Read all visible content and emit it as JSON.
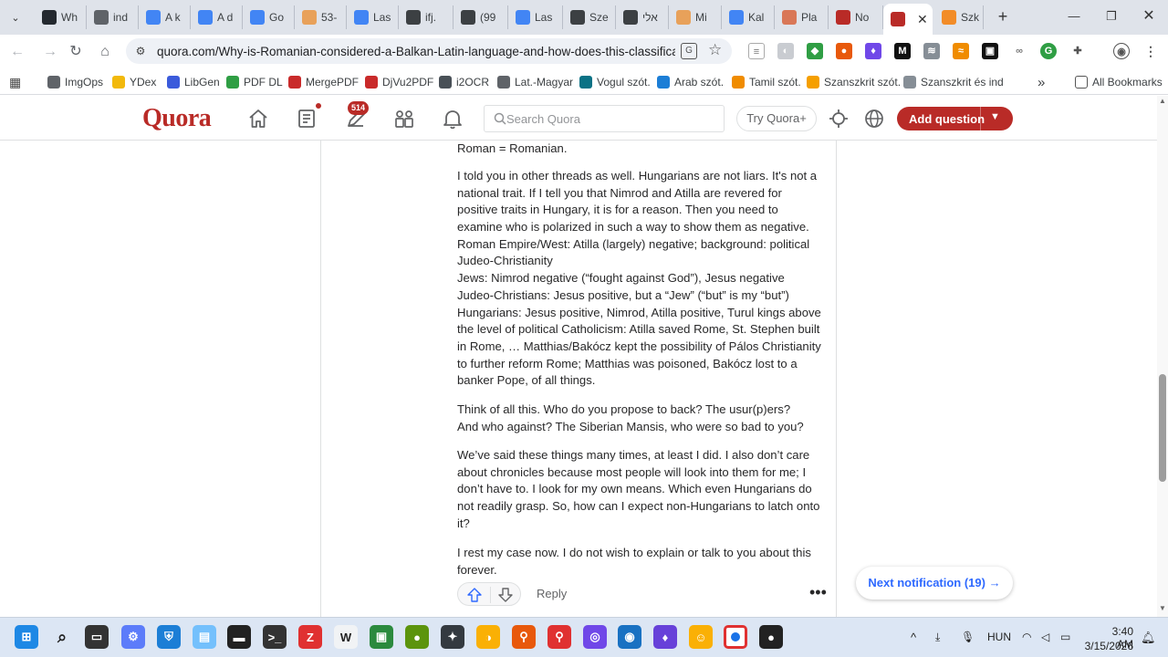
{
  "tabs": [
    {
      "label": "Wh",
      "icon": "github-icon",
      "color": "#24292f"
    },
    {
      "label": "ind",
      "icon": "document-icon",
      "color": "#5f6368"
    },
    {
      "label": "A k",
      "icon": "google-icon",
      "color": "#4285f4"
    },
    {
      "label": "A d",
      "icon": "google-icon",
      "color": "#4285f4"
    },
    {
      "label": "Go",
      "icon": "google-icon",
      "color": "#4285f4"
    },
    {
      "label": "53-",
      "icon": "b-icon",
      "color": "#e8a15a"
    },
    {
      "label": "Las",
      "icon": "google-icon",
      "color": "#4285f4"
    },
    {
      "label": "ifj.",
      "icon": "a-icon",
      "color": "#3c4043"
    },
    {
      "label": "(99",
      "icon": "a-icon",
      "color": "#3c4043"
    },
    {
      "label": "Las",
      "icon": "google-icon",
      "color": "#4285f4"
    },
    {
      "label": "Sze",
      "icon": "wikipedia-icon",
      "color": "#3c4043"
    },
    {
      "label": "אלי",
      "icon": "w-box-icon",
      "color": "#3c4043"
    },
    {
      "label": "Mi",
      "icon": "b-icon",
      "color": "#e8a15a"
    },
    {
      "label": "Kal",
      "icon": "google-icon",
      "color": "#4285f4"
    },
    {
      "label": "Pla",
      "icon": "claude-icon",
      "color": "#d97757"
    },
    {
      "label": "No",
      "icon": "quora-icon",
      "color": "#b92b27"
    },
    {
      "label": "",
      "icon": "quora-icon",
      "color": "#b92b27",
      "active": true
    },
    {
      "label": "Szk",
      "icon": "b-icon",
      "color": "#f28c28"
    }
  ],
  "address": {
    "url": "quora.com/Why-is-Romanian-considered-a-Balkan-Latin-language-and-how-does-this-classification-..."
  },
  "bookmarks": [
    {
      "label": "ImgOps",
      "icon": "globe-icon",
      "color": "#5f6368"
    },
    {
      "label": "YDex",
      "icon": "ydex-icon",
      "color": "#f2b90c"
    },
    {
      "label": "LibGen",
      "icon": "libgen-icon",
      "color": "#3b5bdb"
    },
    {
      "label": "PDF DL",
      "icon": "pdf-dl-icon",
      "color": "#2f9e44"
    },
    {
      "label": "MergePDF",
      "icon": "mergepdf-icon",
      "color": "#c92a2a"
    },
    {
      "label": "DjVu2PDF",
      "icon": "pdf-icon",
      "color": "#c92a2a"
    },
    {
      "label": "i2OCR",
      "icon": "ocr-icon",
      "color": "#495057"
    },
    {
      "label": "Lat.-Magyar",
      "icon": "globe-icon",
      "color": "#5f6368"
    },
    {
      "label": "Vogul szót.",
      "icon": "dictionary-icon",
      "color": "#0b7285"
    },
    {
      "label": "Arab szót.",
      "icon": "dictionary-icon",
      "color": "#1c7ed6"
    },
    {
      "label": "Tamil szót.",
      "icon": "dictionary-icon",
      "color": "#f08c00"
    },
    {
      "label": "Szanszkrit szót.",
      "icon": "dictionary-icon",
      "color": "#f59f00"
    },
    {
      "label": "Szanszkrit és ind",
      "icon": "dictionary-icon",
      "color": "#868e96"
    }
  ],
  "bookmarks_more": "»",
  "all_bookmarks": "All Bookmarks",
  "quora": {
    "logo": "Quora",
    "notif_count": "514",
    "search_placeholder": "Search Quora",
    "try_label": "Try Quora+",
    "add_question": "Add question",
    "accent": "#b92b27"
  },
  "answer": {
    "paragraphs": [
      [
        "Roman = Romanian."
      ],
      [
        "I told you in other threads as well. Hungarians are not liars. It's not a",
        "national trait. If I tell you that Nimrod and Atilla are revered for",
        "positive traits in Hungary, it is for a reason. Then you need to",
        "examine who is polarized in such a way to show them as negative.",
        "Roman Empire/West: Atilla (largely) negative; background: political",
        "Judeo-Christianity",
        "Jews: Nimrod negative (“fought against God”), Jesus negative",
        "Judeo-Christians: Jesus positive, but a “Jew” (“but” is my “but”)",
        "Hungarians: Jesus positive, Nimrod, Atilla positive, Turul kings above",
        "the level of political Catholicism: Atilla saved Rome, St. Stephen built",
        "in Rome, … Matthias/Bakócz kept the possibility of Pálos Christianity",
        "to further reform Rome; Matthias was poisoned, Bakócz lost to a",
        "banker Pope, of all things."
      ],
      [
        "Think of all this. Who do you propose to back? The usur(p)ers?",
        "And who against? The Siberian Mansis, who were so bad to you?"
      ],
      [
        "We’ve said these things many times, at least I did. I also don’t care",
        "about chronicles because most people will look into them for me; I",
        "don’t have to. I look for my own means. Which even Hungarians do",
        "not readily grasp. So, how can I expect non-Hungarians to latch onto",
        "it?"
      ],
      [
        "I rest my case now. I do not wish to explain or talk to you about this",
        "forever."
      ]
    ],
    "reply_label": "Reply",
    "more_label": "•••"
  },
  "next_notification": "Next notification (19) →",
  "taskbar": {
    "language": "HUN",
    "time": "3:40 AM",
    "date": "3/15/2026",
    "tray_chevron": "^"
  }
}
